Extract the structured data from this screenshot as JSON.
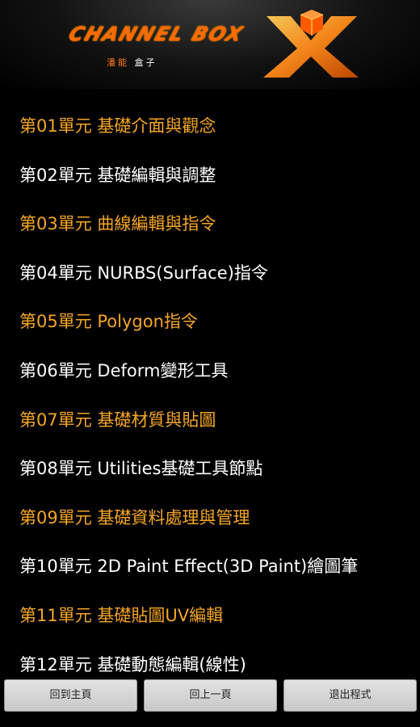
{
  "header": {
    "logo_text": "CHANNEL BOX",
    "logo_sub_accent": "潘能",
    "logo_sub_rest": "盒子"
  },
  "menu": {
    "items": [
      {
        "label": "第01單元 基礎介面與觀念",
        "color": "#f5a623"
      },
      {
        "label": "第02單元 基礎編輯與調整",
        "color": "#ffffff"
      },
      {
        "label": "第03單元 曲線編輯與指令",
        "color": "#f5a623"
      },
      {
        "label": "第04單元 NURBS(Surface)指令",
        "color": "#ffffff"
      },
      {
        "label": "第05單元 Polygon指令",
        "color": "#f5a623"
      },
      {
        "label": "第06單元 Deform變形工具",
        "color": "#ffffff"
      },
      {
        "label": "第07單元 基礎材質與貼圖",
        "color": "#f5a623"
      },
      {
        "label": "第08單元 Utilities基礎工具節點",
        "color": "#ffffff"
      },
      {
        "label": "第09單元 基礎資料處理與管理",
        "color": "#f5a623"
      },
      {
        "label": "第10單元 2D Paint Effect(3D Paint)繪圖筆",
        "color": "#ffffff"
      },
      {
        "label": "第11單元 基礎貼圖UV編輯",
        "color": "#f5a623"
      },
      {
        "label": "第12單元 基礎動態編輯(線性)",
        "color": "#ffffff"
      }
    ]
  },
  "buttons": {
    "home_label": "回到主頁",
    "back_label": "回上一頁",
    "exit_label": "退出程式"
  },
  "colors": {
    "background": "#000000",
    "accent_orange": "#f5a623",
    "text_white": "#ffffff",
    "button_bg": "#d6d6d6"
  }
}
